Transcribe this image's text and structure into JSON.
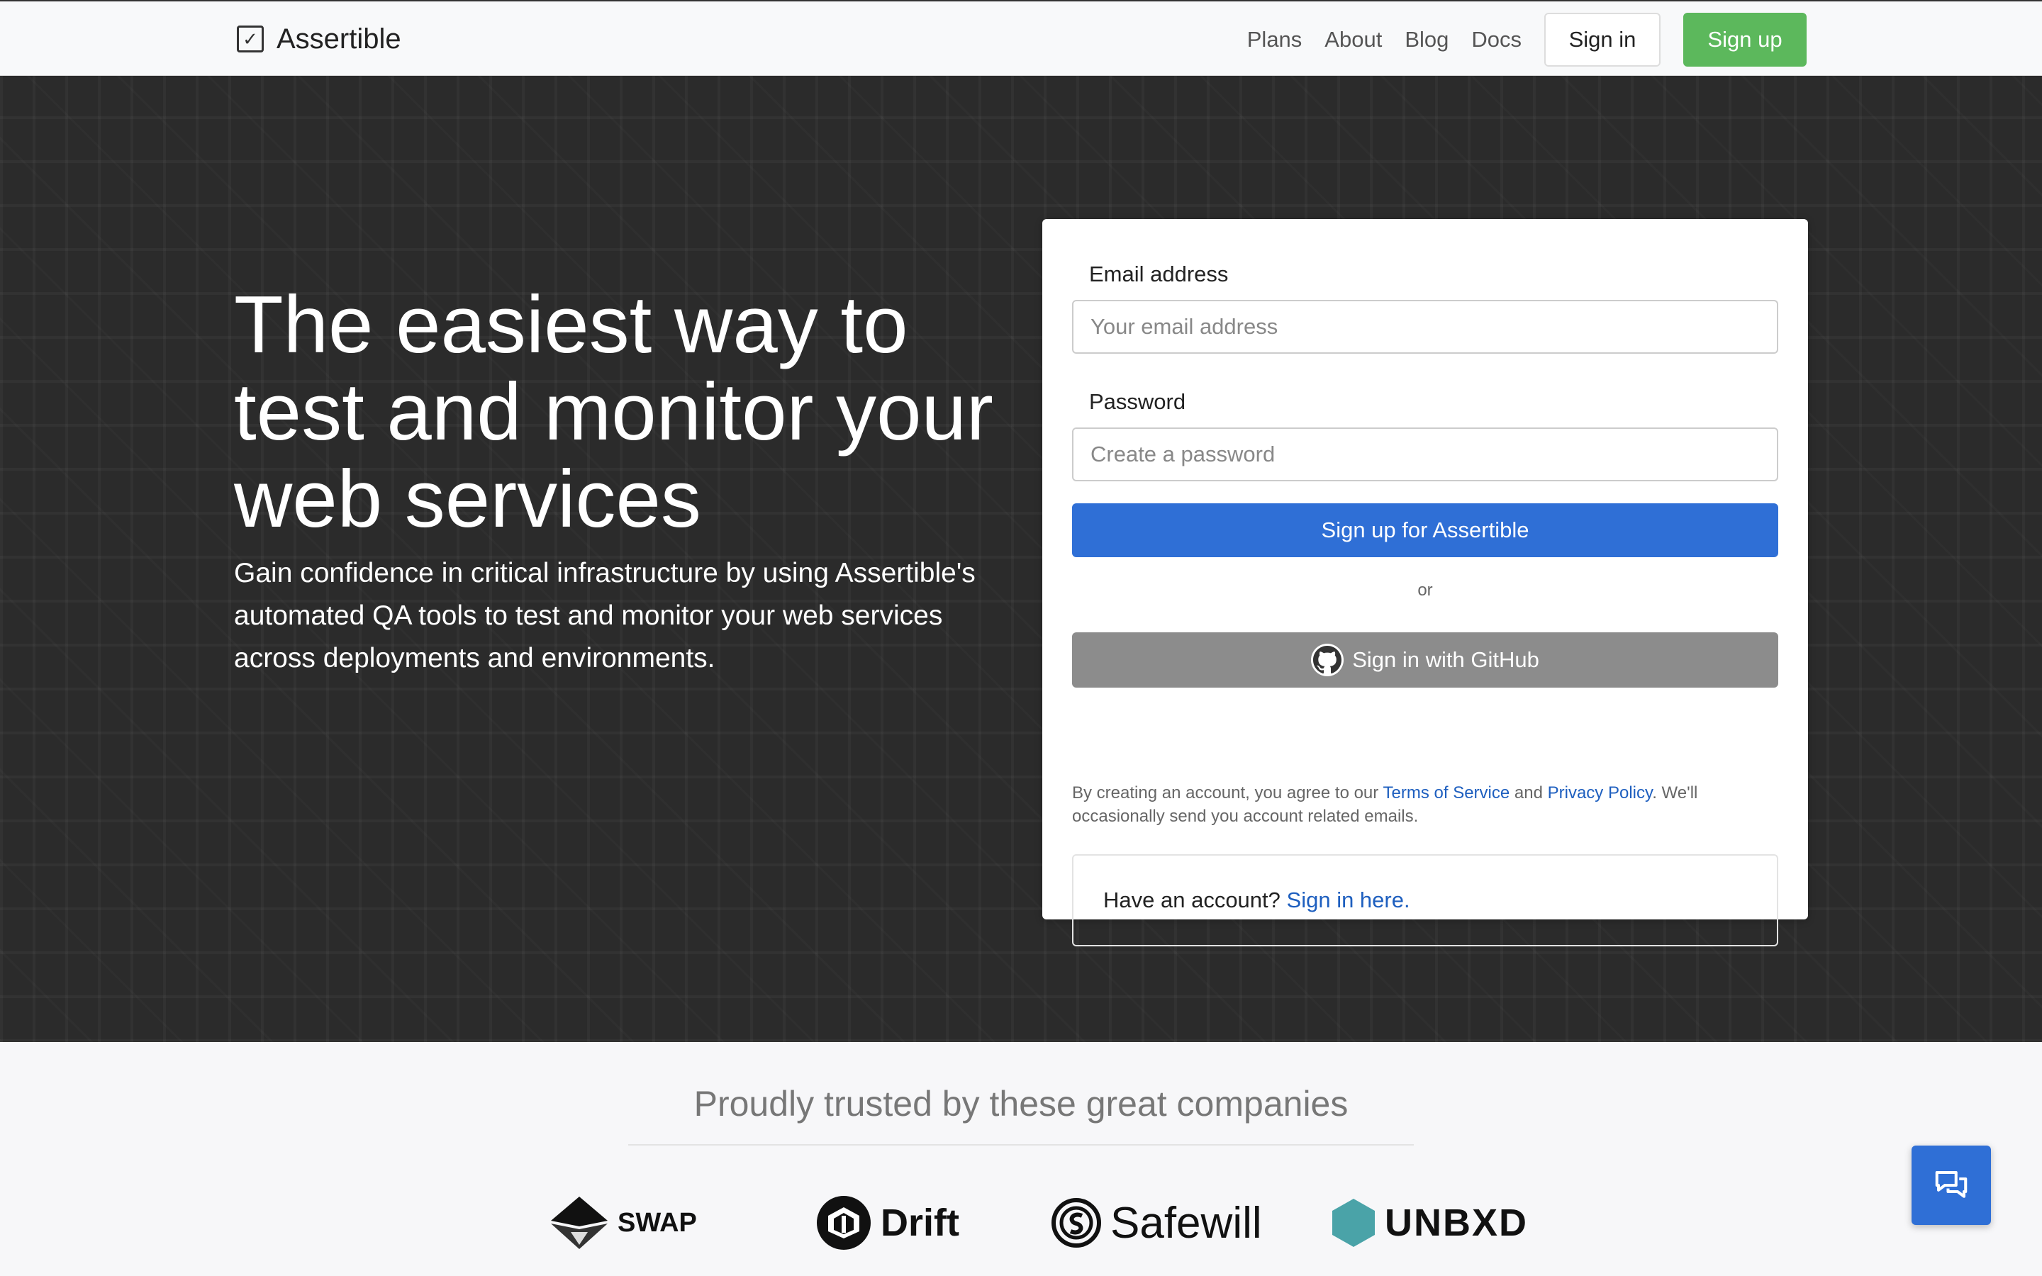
{
  "nav": {
    "brand": "Assertible",
    "links": [
      "Plans",
      "About",
      "Blog",
      "Docs"
    ],
    "signin_label": "Sign in",
    "signup_label": "Sign up"
  },
  "hero": {
    "title": "The easiest way to test and monitor your web services",
    "subtitle": "Gain confidence in critical infrastructure by using Assertible's automated QA tools to test and monitor your web services across deployments and environments."
  },
  "form": {
    "email_label": "Email address",
    "email_placeholder": "Your email address",
    "password_label": "Password",
    "password_placeholder": "Create a password",
    "submit_label": "Sign up for Assertible",
    "or_text": "or",
    "github_label": "Sign in with GitHub",
    "terms_prefix": "By creating an account, you agree to our",
    "terms_link": "Terms of Service",
    "terms_and": "and",
    "privacy_link": "Privacy Policy",
    "terms_suffix": ". We'll occasionally send you account related emails.",
    "account_prompt": "Have an account?",
    "account_link": "Sign in here."
  },
  "trusted": {
    "title": "Proudly trusted by these great companies",
    "logos": [
      "SWAP",
      "Drift",
      "Safewill",
      "UNBXD"
    ]
  },
  "colors": {
    "primary": "#2f6fd6",
    "signup_green": "#5cb85c",
    "github_gray": "#8c8c8c",
    "hero_bg": "#2b2b2b",
    "unbxd_teal": "#4aa3a8"
  },
  "icons": {
    "brand": "checkbox-icon",
    "github": "github-icon",
    "chat": "chat-icon"
  }
}
